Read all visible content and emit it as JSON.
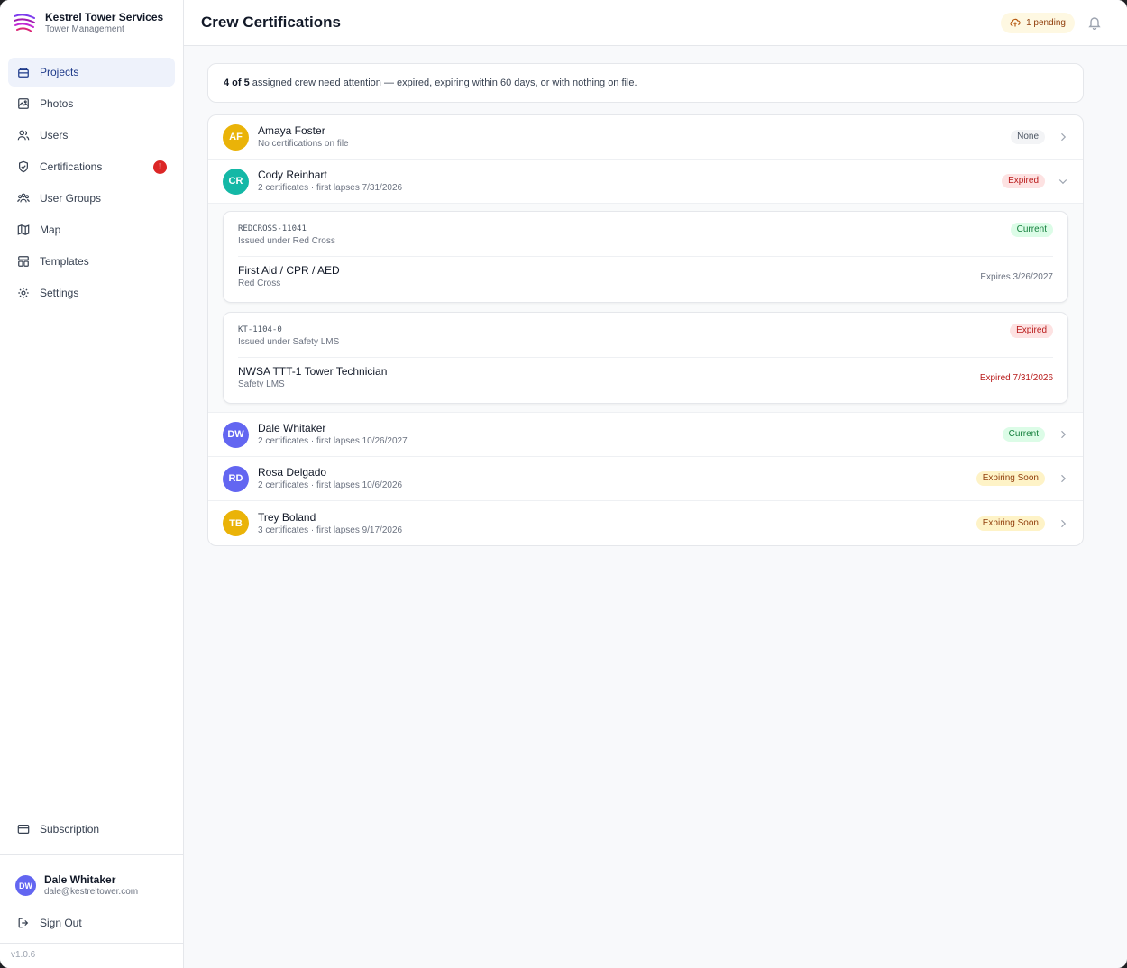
{
  "brand": {
    "title": "Kestrel Tower Services",
    "subtitle": "Tower Management"
  },
  "sidebar": {
    "items": [
      {
        "label": "Projects",
        "icon": "projects-icon",
        "active": true
      },
      {
        "label": "Photos",
        "icon": "photos-icon"
      },
      {
        "label": "Users",
        "icon": "users-icon"
      },
      {
        "label": "Certifications",
        "icon": "shield-check-icon",
        "badge": "!"
      },
      {
        "label": "User Groups",
        "icon": "user-groups-icon"
      },
      {
        "label": "Map",
        "icon": "map-icon"
      },
      {
        "label": "Templates",
        "icon": "templates-icon"
      },
      {
        "label": "Settings",
        "icon": "gear-icon"
      }
    ],
    "subscription_label": "Subscription",
    "user": {
      "initials": "DW",
      "name": "Dale Whitaker",
      "email": "dale@kestreltower.com"
    },
    "signout_label": "Sign Out",
    "version": "v1.0.6"
  },
  "header": {
    "title": "Crew Certifications",
    "pending_label": "1 pending"
  },
  "summary": {
    "count": "4 of 5",
    "text": "assigned crew need attention — expired, expiring within 60 days, or with nothing on file."
  },
  "crew": [
    {
      "initials": "AF",
      "name": "Amaya Foster",
      "meta": "No certifications on file",
      "status": "None",
      "avatar_color": "#eab308"
    },
    {
      "initials": "CR",
      "name": "Cody Reinhart",
      "meta": "2 certificates · first lapses 7/31/2026",
      "status": "Expired",
      "avatar_color": "#14b8a6",
      "certificates": [
        {
          "id": "REDCROSS-11041",
          "issued_under": "Issued under Red Cross",
          "status": "Current",
          "name": "First Aid / CPR / AED",
          "org": "Red Cross",
          "expiry": "Expires 3/26/2027"
        },
        {
          "id": "KT-1104-0",
          "issued_under": "Issued under Safety LMS",
          "status": "Expired",
          "name": "NWSA TTT-1 Tower Technician",
          "org": "Safety LMS",
          "expiry": "Expired 7/31/2026"
        }
      ]
    },
    {
      "initials": "DW",
      "name": "Dale Whitaker",
      "meta": "2 certificates · first lapses 10/26/2027",
      "status": "Current",
      "avatar_color": "#6366f1"
    },
    {
      "initials": "RD",
      "name": "Rosa Delgado",
      "meta": "2 certificates · first lapses 10/6/2026",
      "status": "Expiring Soon",
      "avatar_color": "#6366f1"
    },
    {
      "initials": "TB",
      "name": "Trey Boland",
      "meta": "3 certificates · first lapses 9/17/2026",
      "status": "Expiring Soon",
      "avatar_color": "#eab308"
    }
  ],
  "colors": {
    "accent": "#1e3a8a",
    "status_none_bg": "#f3f4f6",
    "status_expired_bg": "#fde2e2",
    "status_current_bg": "#dcfce7",
    "status_expiring_bg": "#fef3c7"
  }
}
